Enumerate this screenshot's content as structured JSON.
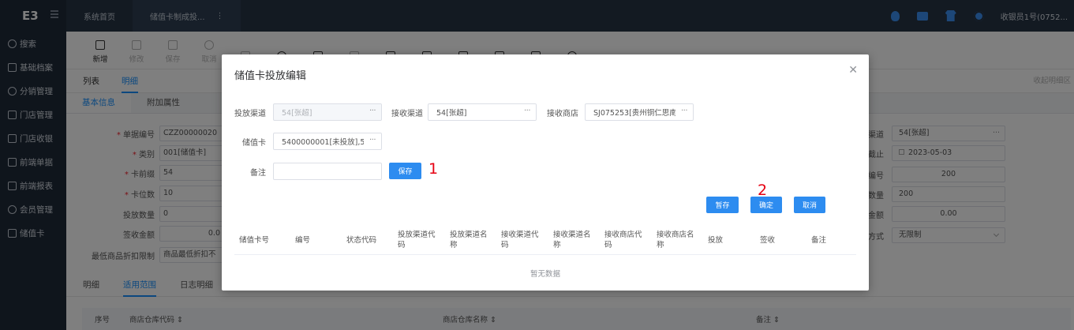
{
  "sidebar": {
    "logo": "E3",
    "items": [
      {
        "label": "搜索",
        "icon": "search-icon"
      },
      {
        "label": "基础档案",
        "icon": "archive-icon"
      },
      {
        "label": "分销管理",
        "icon": "distribution-icon"
      },
      {
        "label": "门店管理",
        "icon": "store-icon"
      },
      {
        "label": "门店收银",
        "icon": "cashier-icon"
      },
      {
        "label": "前端单据",
        "icon": "document-icon"
      },
      {
        "label": "前端报表",
        "icon": "report-icon"
      },
      {
        "label": "会员管理",
        "icon": "member-icon"
      },
      {
        "label": "储值卡",
        "icon": "card-icon"
      }
    ]
  },
  "topbar": {
    "tabs": [
      {
        "label": "系统首页"
      },
      {
        "label": "储值卡制成投..."
      }
    ],
    "tab_more": "⋮",
    "user": "收银员1号(0752..."
  },
  "toolbar": {
    "buttons": [
      {
        "label": "新增",
        "enabled": true
      },
      {
        "label": "修改",
        "enabled": false
      },
      {
        "label": "保存",
        "enabled": false
      },
      {
        "label": "取消",
        "enabled": false
      },
      {
        "label": "",
        "enabled": false
      },
      {
        "label": "",
        "enabled": true
      },
      {
        "label": "",
        "enabled": true
      },
      {
        "label": "",
        "enabled": false
      },
      {
        "label": "",
        "enabled": true
      },
      {
        "label": "",
        "enabled": true
      },
      {
        "label": "",
        "enabled": true
      },
      {
        "label": "",
        "enabled": true
      },
      {
        "label": "",
        "enabled": true
      },
      {
        "label": "",
        "enabled": true
      }
    ]
  },
  "subtabs": [
    "列表",
    "明细"
  ],
  "subtabs_right": "收起明细区",
  "infotabs": [
    "基本信息",
    "附加属性"
  ],
  "form_left": [
    {
      "label": "单据编号",
      "required": true,
      "value": "CZZ00000020"
    },
    {
      "label": "类别",
      "required": true,
      "value": "001[储值卡]"
    },
    {
      "label": "卡前缀",
      "required": true,
      "value": "54"
    },
    {
      "label": "卡位数",
      "required": true,
      "value": "10"
    },
    {
      "label": "投放数量",
      "required": false,
      "value": "0"
    },
    {
      "label": "签收金额",
      "required": false,
      "value": "0.0"
    },
    {
      "label": "最低商品折扣限制",
      "required": false,
      "value": "商品最低折扣不"
    }
  ],
  "form_right": [
    {
      "label": "渠道",
      "value": "54[张超]"
    },
    {
      "label": "截止",
      "value": "2023-05-03"
    },
    {
      "label": "编号",
      "value": "200"
    },
    {
      "label": "数量",
      "value": "200"
    },
    {
      "label": "金额",
      "value": "0.00"
    },
    {
      "label": "方式",
      "value": "无限制"
    }
  ],
  "bottom_tabs": [
    "明细",
    "适用范围",
    "日志明细"
  ],
  "bottom_table": {
    "headers": [
      "序号",
      "商店仓库代码 ⇕",
      "商店仓库名称 ⇕",
      "备注 ⇕"
    ]
  },
  "modal": {
    "title": "储值卡投放编辑",
    "fields": {
      "release_channel": {
        "label": "投放渠道",
        "value": "54[张超]"
      },
      "receive_channel": {
        "label": "接收渠道",
        "value": "54[张超]"
      },
      "receive_store": {
        "label": "接收商店",
        "value": "SJ075253[贵州铜仁思南]"
      },
      "card": {
        "label": "储值卡",
        "value": "5400000001[未投放],54("
      },
      "remark": {
        "label": "备注",
        "value": "",
        "placeholder": ""
      }
    },
    "ellipsis": "···",
    "buttons": {
      "save": "保存",
      "temp_save": "暂存",
      "confirm": "确定",
      "cancel": "取消"
    },
    "annotations": {
      "mark1": "1",
      "mark2": "2"
    },
    "table": {
      "columns": [
        "储值卡号",
        "编号",
        "状态代码",
        "投放渠道代码",
        "投放渠道名称",
        "接收渠道代码",
        "接收渠道名称",
        "接收商店代码",
        "接收商店名称",
        "投放",
        "签收",
        "备注"
      ],
      "empty_text": "暂无数据"
    }
  },
  "colors": {
    "sidebar_bg": "#1f2a38",
    "topbar_bg": "#263445",
    "accent": "#2d8cf0",
    "annotation_red": "#e60012"
  }
}
